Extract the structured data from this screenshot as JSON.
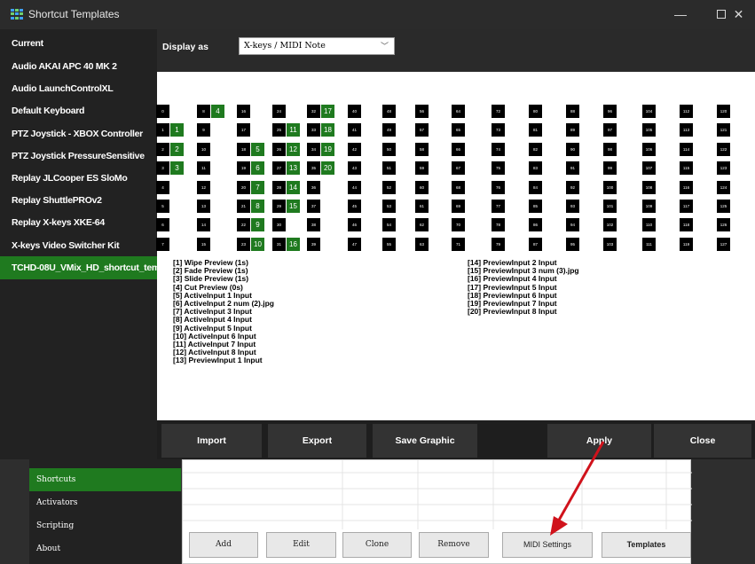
{
  "window": {
    "title": "Shortcut Templates",
    "controls": {
      "minimize": "—",
      "close": "✕"
    }
  },
  "sidebar": {
    "items": [
      {
        "label": "Current"
      },
      {
        "label": "Audio AKAI APC 40 MK 2"
      },
      {
        "label": "Audio LaunchControlXL"
      },
      {
        "label": "Default Keyboard"
      },
      {
        "label": "PTZ Joystick - XBOX Controller"
      },
      {
        "label": "PTZ Joystick PressureSensitive"
      },
      {
        "label": "Replay JLCooper ES SloMo"
      },
      {
        "label": "Replay ShuttlePROv2"
      },
      {
        "label": "Replay X-keys XKE-64"
      },
      {
        "label": "X-keys Video Switcher Kit"
      },
      {
        "label": "TCHD-08U_VMix_HD_shortcut_tem"
      }
    ],
    "active_index": 10
  },
  "display": {
    "label": "Display as",
    "selected": "X-keys / MIDI Note"
  },
  "key_grid": {
    "columns": [
      {
        "cells": [
          "0",
          "1",
          "2",
          "3",
          "4",
          "5",
          "6",
          "7"
        ]
      },
      {
        "cells": [
          "",
          "1",
          "2",
          "3",
          "",
          "",
          "",
          ""
        ]
      },
      {
        "cells": [
          "8",
          "9",
          "10",
          "11",
          "12",
          "13",
          "14",
          "15"
        ]
      },
      {
        "cells": [
          "4",
          "",
          "",
          "",
          "",
          "",
          "",
          ""
        ]
      },
      {
        "cells": [
          "16",
          "17",
          "18",
          "19",
          "20",
          "21",
          "22",
          "23"
        ]
      },
      {
        "cells": [
          "",
          "",
          "5",
          "6",
          "7",
          "8",
          "9",
          "10"
        ]
      },
      {
        "cells": [
          "24",
          "25",
          "26",
          "27",
          "28",
          "29",
          "30",
          "31"
        ]
      },
      {
        "cells": [
          "",
          "11",
          "12",
          "13",
          "14",
          "15",
          "",
          "16"
        ]
      },
      {
        "cells": [
          "32",
          "33",
          "34",
          "35",
          "36",
          "37",
          "38",
          "39"
        ]
      },
      {
        "cells": [
          "17",
          "18",
          "19",
          "20",
          "",
          "",
          "",
          ""
        ]
      },
      {
        "cells": [
          "40",
          "41",
          "42",
          "43",
          "44",
          "45",
          "46",
          "47"
        ]
      },
      {
        "cells": [
          "48",
          "49",
          "50",
          "51",
          "52",
          "53",
          "54",
          "55"
        ]
      },
      {
        "cells": [
          "56",
          "57",
          "58",
          "59",
          "60",
          "61",
          "62",
          "63"
        ]
      },
      {
        "cells": [
          "64",
          "65",
          "66",
          "67",
          "68",
          "69",
          "70",
          "71"
        ]
      },
      {
        "cells": [
          "72",
          "73",
          "74",
          "75",
          "76",
          "77",
          "78",
          "79"
        ]
      },
      {
        "cells": [
          "80",
          "81",
          "82",
          "83",
          "84",
          "85",
          "86",
          "87"
        ]
      },
      {
        "cells": [
          "88",
          "89",
          "90",
          "91",
          "92",
          "93",
          "94",
          "95"
        ]
      },
      {
        "cells": [
          "96",
          "97",
          "98",
          "99",
          "100",
          "101",
          "102",
          "103"
        ]
      },
      {
        "cells": [
          "104",
          "105",
          "106",
          "107",
          "108",
          "109",
          "110",
          "111"
        ]
      },
      {
        "cells": [
          "112",
          "113",
          "114",
          "115",
          "116",
          "117",
          "118",
          "119"
        ]
      },
      {
        "cells": [
          "120",
          "121",
          "122",
          "123",
          "124",
          "125",
          "126",
          "127"
        ]
      }
    ]
  },
  "legend_left": [
    "[1] Wipe Preview (1s)",
    "[2] Fade Preview (1s)",
    "[3] Slide Preview (1s)",
    "[4] Cut Preview (0s)",
    "[5] ActiveInput 1 Input",
    "[6] ActiveInput 2 num (2).jpg",
    "[7] ActiveInput 3 Input",
    "[8] ActiveInput 4 Input",
    "[9] ActiveInput 5 Input",
    "[10] ActiveInput 6 Input",
    "[11] ActiveInput 7 Input",
    "[12] ActiveInput 8 Input",
    "[13] PreviewInput 1 Input"
  ],
  "legend_right": [
    "[14] PreviewInput 2 Input",
    "[15] PreviewInput 3 num (3).jpg",
    "[16] PreviewInput 4 Input",
    "[17] PreviewInput 5 Input",
    "[18] PreviewInput 6 Input",
    "[19] PreviewInput 7 Input",
    "[20] PreviewInput 8 Input"
  ],
  "buttons": {
    "import": "Import",
    "export": "Export",
    "save_graphic": "Save Graphic",
    "apply": "Apply",
    "close": "Close"
  },
  "main_window": {
    "nav": [
      {
        "label": "Shortcuts"
      },
      {
        "label": "Activators"
      },
      {
        "label": "Scripting"
      },
      {
        "label": "About"
      }
    ],
    "active_index": 0,
    "buttons": {
      "add": "Add",
      "edit": "Edit",
      "clone": "Clone",
      "remove": "Remove",
      "midi_settings": "MIDI Settings",
      "templates": "Templates"
    }
  },
  "colors": {
    "accent_green": "#1f7a1f",
    "arrow_red": "#d0121b"
  }
}
